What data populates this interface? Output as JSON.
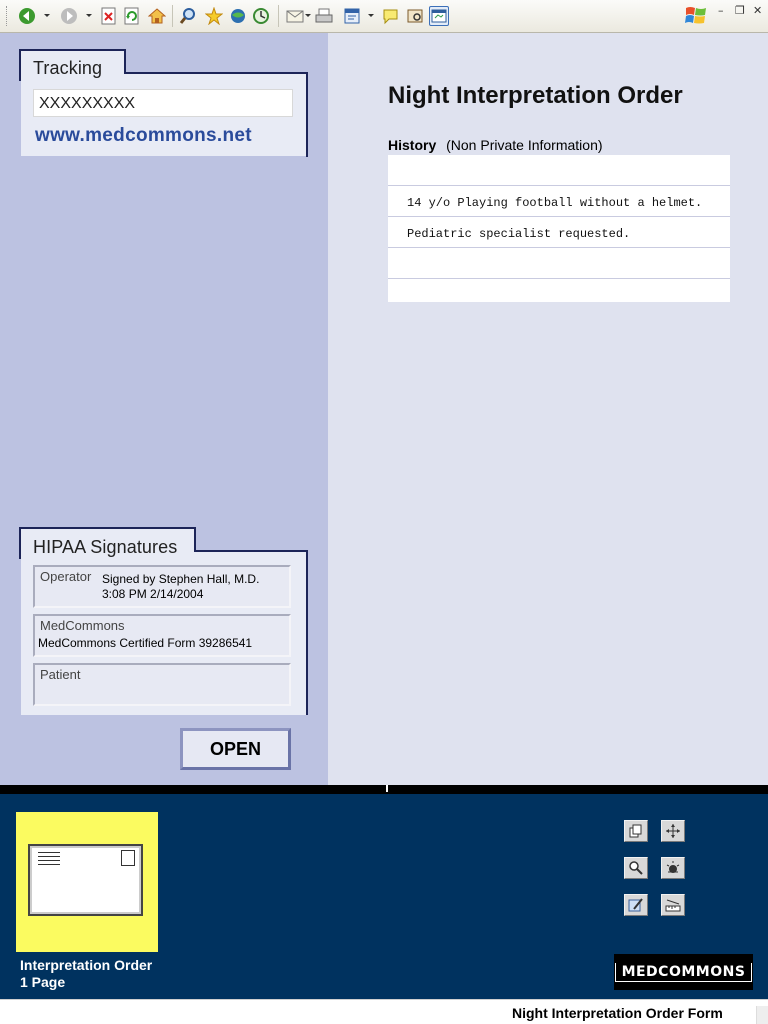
{
  "tracking": {
    "title": "Tracking",
    "number": "XXXXXXXXX",
    "url": "www.medcommons.net"
  },
  "order": {
    "title": "Night Interpretation Order",
    "history_label": "History",
    "history_note": "(Non Private Information)",
    "history_rows": [
      "",
      "14 y/o Playing football without a helmet.",
      "Pediatric specialist requested.",
      "",
      ""
    ]
  },
  "hipaa": {
    "title": "HIPAA Signatures",
    "operator_label": "Operator",
    "operator_line1": "Signed by Stephen Hall, M.D.",
    "operator_line2": "3:08 PM 2/14/2004",
    "medcommons_label": "MedCommons",
    "medcommons_value": "MedCommons Certified Form 39286541",
    "patient_label": "Patient",
    "patient_value": ""
  },
  "open_button": "OPEN",
  "thumbnail": {
    "title": "Interpretation Order",
    "pages": "1 Page"
  },
  "logo": "MEDCOMMONS",
  "footer_title": "Night Interpretation Order Form",
  "toolbar_icons": [
    "back-icon",
    "forward-icon",
    "stop-icon",
    "refresh-icon",
    "home-icon",
    "search-icon",
    "favorites-icon",
    "media-icon",
    "history-icon",
    "mail-icon",
    "print-icon",
    "edit-icon",
    "discuss-icon",
    "research-icon",
    "messenger-icon"
  ],
  "colors": {
    "left_panel": "#bcc2e1",
    "right_panel": "#dfe2ef",
    "navy": "#00325f",
    "thumb": "#fbfb60",
    "url": "#2a4b9b"
  }
}
